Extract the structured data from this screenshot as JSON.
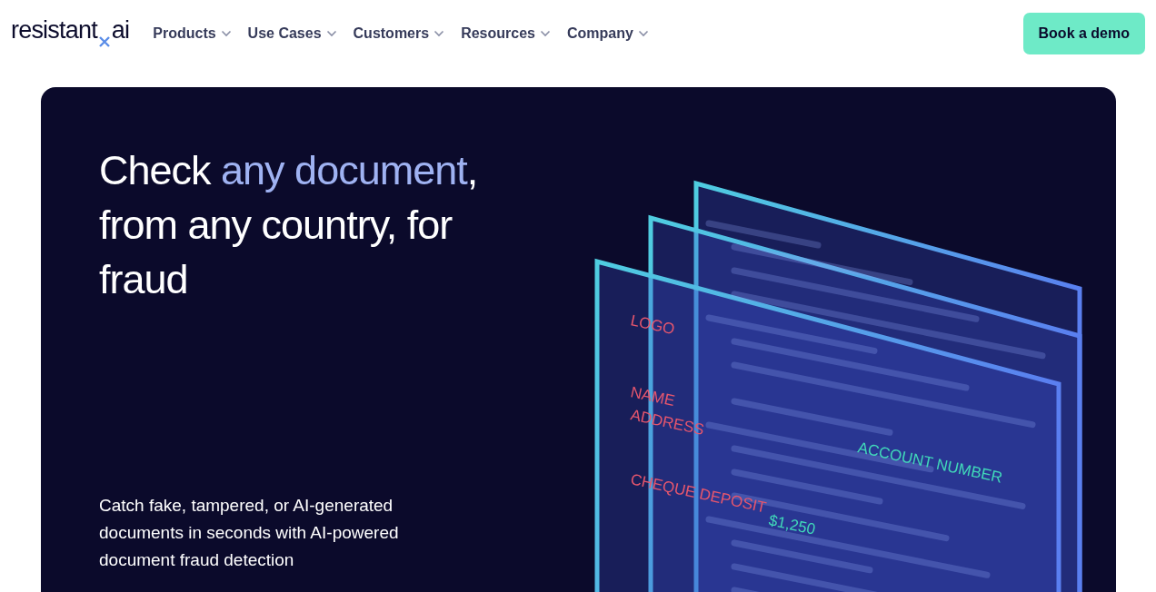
{
  "header": {
    "logo": {
      "left": "resistant",
      "right": "ai"
    },
    "nav": [
      {
        "label": "Products"
      },
      {
        "label": "Use Cases"
      },
      {
        "label": "Customers"
      },
      {
        "label": "Resources"
      },
      {
        "label": "Company"
      }
    ],
    "cta": "Book a demo"
  },
  "hero": {
    "headline": [
      {
        "text": "Check ",
        "accent": false
      },
      {
        "text": "any document",
        "accent": true
      },
      {
        "text": ", from any country, for fraud",
        "accent": false
      }
    ],
    "subtitle": "Catch fake, tampered, or AI-generated documents in seconds with AI-powered document fraud detection",
    "illustration": {
      "labels": [
        {
          "text": "LOGO",
          "kind": "field"
        },
        {
          "text": "NAME",
          "kind": "field"
        },
        {
          "text": "ADDRESS",
          "kind": "field"
        },
        {
          "text": "CHEQUE DEPOSIT",
          "kind": "field"
        },
        {
          "text": "ACCOUNT NUMBER",
          "kind": "value"
        },
        {
          "text": "$1,250",
          "kind": "value"
        }
      ]
    }
  }
}
